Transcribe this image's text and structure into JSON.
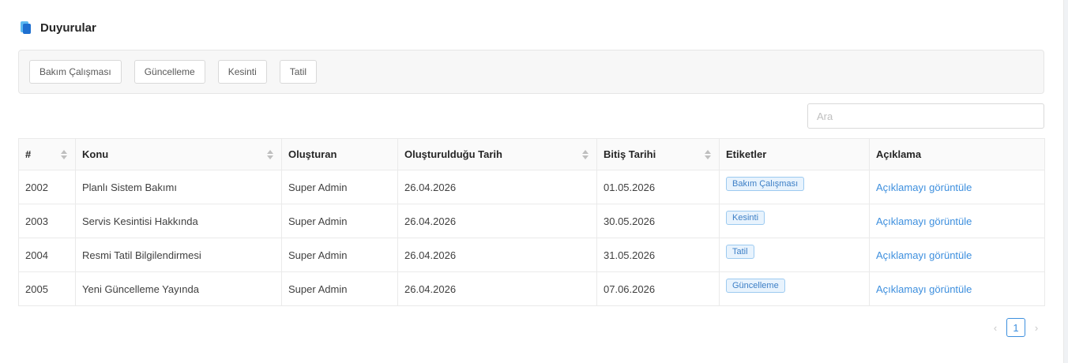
{
  "header": {
    "title": "Duyurular",
    "logo_icon": "app-logo-icon"
  },
  "filters": [
    "Bakım Çalışması",
    "Güncelleme",
    "Kesinti",
    "Tatil"
  ],
  "search": {
    "placeholder": "Ara",
    "value": ""
  },
  "table": {
    "columns": [
      "#",
      "Konu",
      "Oluşturan",
      "Oluşturulduğu Tarih",
      "Bitiş Tarihi",
      "Etiketler",
      "Açıklama"
    ],
    "sortable": [
      true,
      true,
      false,
      true,
      true,
      false,
      false
    ],
    "rows": [
      {
        "id": "2002",
        "subject": "Planlı Sistem Bakımı",
        "creator": "Super Admin",
        "created": "26.04.2026",
        "end": "01.05.2026",
        "tag": "Bakım Çalışması",
        "desc": "Açıklamayı görüntüle"
      },
      {
        "id": "2003",
        "subject": "Servis Kesintisi Hakkında",
        "creator": "Super Admin",
        "created": "26.04.2026",
        "end": "30.05.2026",
        "tag": "Kesinti",
        "desc": "Açıklamayı görüntüle"
      },
      {
        "id": "2004",
        "subject": "Resmi Tatil Bilgilendirmesi",
        "creator": "Super Admin",
        "created": "26.04.2026",
        "end": "31.05.2026",
        "tag": "Tatil",
        "desc": "Açıklamayı görüntüle"
      },
      {
        "id": "2005",
        "subject": "Yeni Güncelleme Yayında",
        "creator": "Super Admin",
        "created": "26.04.2026",
        "end": "07.06.2026",
        "tag": "Güncelleme",
        "desc": "Açıklamayı görüntüle"
      }
    ]
  },
  "pagination": {
    "prev": "‹",
    "current": "1",
    "next": "›"
  },
  "colors": {
    "accent": "#3d8fde",
    "tag_bg": "#e8f3fd",
    "tag_border": "#9ccaf0"
  }
}
